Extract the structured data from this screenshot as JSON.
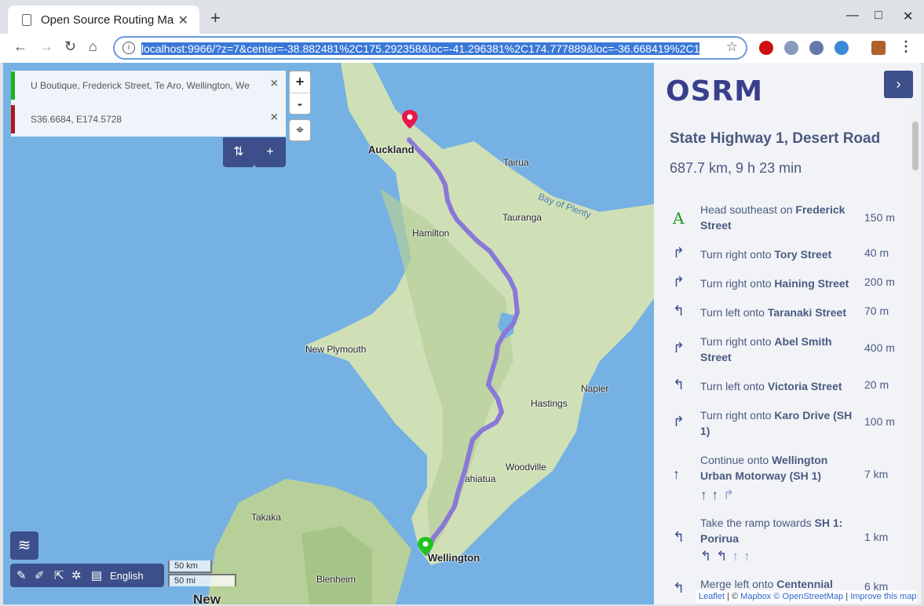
{
  "browser": {
    "tab_title": "Open Source Routing Mac",
    "url": "localhost:9966/?z=7&center=-38.882481%2C175.292358&loc=-41.296381%2C174.777889&loc=-36.668419%2C1"
  },
  "waypoints": [
    {
      "text": "U Boutique, Frederick Street, Te Aro, Wellington, We",
      "color": "#17b617"
    },
    {
      "text": "S36.6684, E174.5728",
      "color": "#b01818"
    }
  ],
  "controls": {
    "reverse_label": "⇅",
    "add_label": "+",
    "zoom_in": "+",
    "zoom_out": "-",
    "language": "English"
  },
  "scale": {
    "km": "50 km",
    "mi": "50 mi"
  },
  "places": [
    {
      "name": "Auckland",
      "big": true
    },
    {
      "name": "Tairua"
    },
    {
      "name": "Bay of Plenty"
    },
    {
      "name": "Tauranga"
    },
    {
      "name": "Hamilton"
    },
    {
      "name": "New Plymouth"
    },
    {
      "name": "Napier"
    },
    {
      "name": "Hastings"
    },
    {
      "name": "Woodville"
    },
    {
      "name": "ahiatua"
    },
    {
      "name": "Takaka"
    },
    {
      "name": "Wellington"
    },
    {
      "name": "Blenheim"
    },
    {
      "name": "New"
    }
  ],
  "sidebar": {
    "logo": "OSRM",
    "collapse": "›",
    "route_title": "State Highway 1, Desert Road",
    "route_summary": "687.7 km, 9 h 23 min",
    "steps": [
      {
        "icon": "A",
        "text": "Head southeast on ",
        "street": "Frederick Street",
        "dist": "150 m"
      },
      {
        "icon": "↱",
        "text": "Turn right onto ",
        "street": "Tory Street",
        "dist": "40 m"
      },
      {
        "icon": "↱",
        "text": "Turn right onto ",
        "street": "Haining Street",
        "dist": "200 m"
      },
      {
        "icon": "↰",
        "text": "Turn left onto ",
        "street": "Taranaki Street",
        "dist": "70 m"
      },
      {
        "icon": "↱",
        "text": "Turn right onto ",
        "street": "Abel Smith Street",
        "dist": "400 m"
      },
      {
        "icon": "↰",
        "text": "Turn left onto ",
        "street": "Victoria Street",
        "dist": "20 m"
      },
      {
        "icon": "↱",
        "text": "Turn right onto ",
        "street": "Karo Drive (SH 1)",
        "dist": "100 m"
      },
      {
        "icon": "↑",
        "text": "Continue onto ",
        "street": "Wellington Urban Motorway (SH 1)",
        "dist": "7 km"
      },
      {
        "icon": "↰",
        "text": "Take the ramp towards ",
        "street": "SH 1: Porirua",
        "dist": "1 km"
      },
      {
        "icon": "↰",
        "text": "Merge left onto ",
        "street": "Centennial",
        "dist": "6 km"
      }
    ]
  },
  "attribution": {
    "leaflet": "Leaflet",
    "sep": " | © ",
    "mapbox": "Mapbox",
    "osm": "© OpenStreetMap",
    "improve": "Improve this map"
  }
}
